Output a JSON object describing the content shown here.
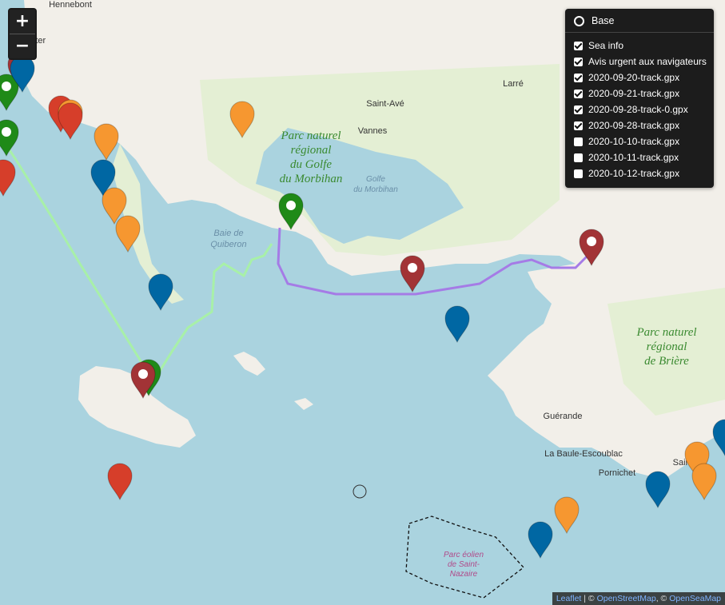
{
  "map": {
    "place_labels": [
      {
        "id": "hennebont",
        "text": "Hennebont"
      },
      {
        "id": "ster",
        "text": "ster"
      },
      {
        "id": "larre",
        "text": "Larré"
      },
      {
        "id": "saint-ave",
        "text": "Saint-Avé"
      },
      {
        "id": "vannes",
        "text": "Vannes"
      },
      {
        "id": "baie1",
        "text": "Baie de"
      },
      {
        "id": "baie2",
        "text": "Quiberon"
      },
      {
        "id": "golfe1",
        "text": "Golfe"
      },
      {
        "id": "golfe2",
        "text": "du Morbihan"
      },
      {
        "id": "guerande",
        "text": "Guérande"
      },
      {
        "id": "labaule",
        "text": "La Baule-Escoublac"
      },
      {
        "id": "pornichet",
        "text": "Pornichet"
      },
      {
        "id": "saintn",
        "text": "Saint-N"
      }
    ],
    "park_labels": [
      {
        "id": "pnr-morbihan",
        "lines": [
          "Parc naturel",
          "régional",
          "du Golfe",
          "du Morbihan"
        ]
      },
      {
        "id": "pnr-briere",
        "lines": [
          "Parc naturel",
          "régional",
          "de Brière"
        ]
      }
    ],
    "eolien_label": [
      "Parc éolien",
      "de Saint-",
      "Nazaire"
    ],
    "colors": {
      "sea": "#aad3df",
      "land": "#f2efe9",
      "green_land": "#d6e9c0",
      "forest": "#add19e",
      "track_purple": "#a57be6",
      "track_green": "#a8f0a8",
      "marker_red": "#d63e2a",
      "marker_orange": "#f69730",
      "marker_blue": "#0067a3",
      "marker_green": "#72b026",
      "marker_darkred": "#a23336",
      "marker_darkgreen": "#1f8a18"
    }
  },
  "zoom": {
    "in": "+",
    "out": "−"
  },
  "layers": {
    "base_label": "Base",
    "overlays": [
      {
        "label": "Sea info",
        "checked": true
      },
      {
        "label": "Avis urgent aux navigateurs",
        "checked": true
      },
      {
        "label": "2020-09-20-track.gpx",
        "checked": true
      },
      {
        "label": "2020-09-21-track.gpx",
        "checked": true
      },
      {
        "label": "2020-09-28-track-0.gpx",
        "checked": true
      },
      {
        "label": "2020-09-28-track.gpx",
        "checked": true
      },
      {
        "label": "2020-10-10-track.gpx",
        "checked": false
      },
      {
        "label": "2020-10-11-track.gpx",
        "checked": false
      },
      {
        "label": "2020-10-12-track.gpx",
        "checked": false
      }
    ]
  },
  "attribution": {
    "leaflet": "Leaflet",
    "sep1": " | © ",
    "osm": "OpenStreetMap",
    "sep2": ", © ",
    "osea": "OpenSeaMap"
  }
}
